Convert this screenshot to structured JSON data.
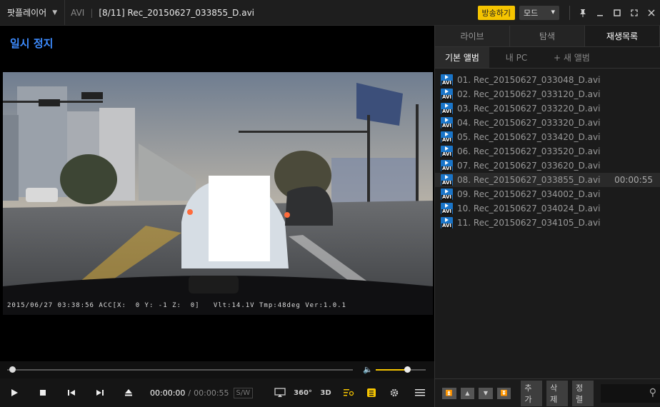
{
  "titlebar": {
    "app_name": "팟플레이어",
    "format": "AVI",
    "sep": "|",
    "title": "[8/11]  Rec_20150627_033855_D.avi",
    "broadcast_label": "방송하기",
    "mode_label": "모드"
  },
  "status": {
    "pause_label": "일시 정지"
  },
  "video": {
    "overlay_text": "2015/06/27 03:38:56 ACC[X:  0 Y: -1 Z:  0]   Vlt:14.1V Tmp:48deg Ver:1.0.1"
  },
  "playback": {
    "progress": 0.0,
    "volume": 0.7,
    "current_time": "00:00:00",
    "divider": "/",
    "total_time": "00:00:55",
    "sw_label": "S/W",
    "label_360": "360°",
    "label_3d": "3D"
  },
  "panel": {
    "tabs": [
      "라이브",
      "탐색",
      "재생목록"
    ],
    "subtabs": {
      "basic": "기본 앨범",
      "mypc": "내 PC",
      "new": "+ 새 앨범"
    },
    "playlist": [
      {
        "name": "01. Rec_20150627_033048_D.avi",
        "duration": ""
      },
      {
        "name": "02. Rec_20150627_033120_D.avi",
        "duration": ""
      },
      {
        "name": "03. Rec_20150627_033220_D.avi",
        "duration": ""
      },
      {
        "name": "04. Rec_20150627_033320_D.avi",
        "duration": ""
      },
      {
        "name": "05. Rec_20150627_033420_D.avi",
        "duration": ""
      },
      {
        "name": "06. Rec_20150627_033520_D.avi",
        "duration": ""
      },
      {
        "name": "07. Rec_20150627_033620_D.avi",
        "duration": ""
      },
      {
        "name": "08. Rec_20150627_033855_D.avi",
        "duration": "00:00:55"
      },
      {
        "name": "09. Rec_20150627_034002_D.avi",
        "duration": ""
      },
      {
        "name": "10. Rec_20150627_034024_D.avi",
        "duration": ""
      },
      {
        "name": "11. Rec_20150627_034105_D.avi",
        "duration": ""
      }
    ],
    "actions": {
      "add": "추가",
      "delete": "삭제",
      "sort": "정렬"
    }
  },
  "colors": {
    "accent": "#f5c400",
    "pause_text": "#3d8cff",
    "avi_icon": "#1a75c9"
  }
}
